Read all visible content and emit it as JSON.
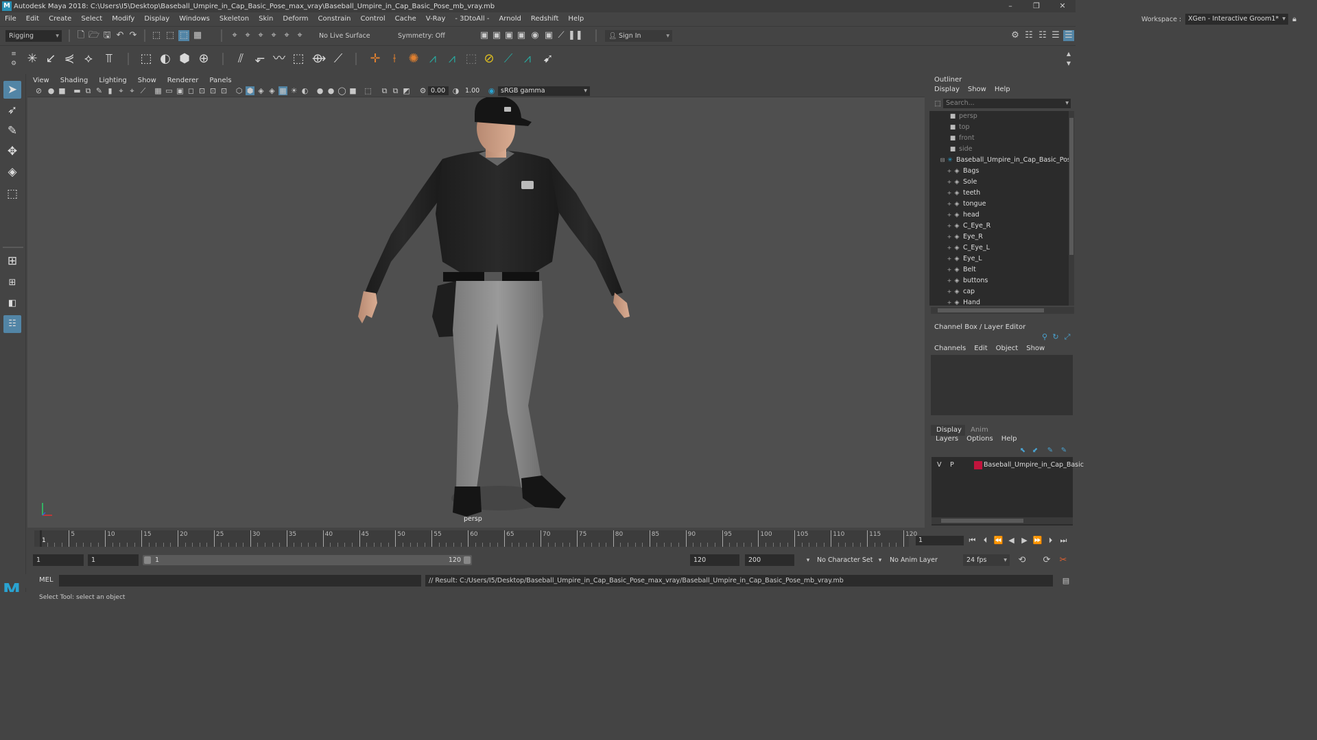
{
  "titlebar": {
    "title": "Autodesk Maya 2018: C:\\Users\\I5\\Desktop\\Baseball_Umpire_in_Cap_Basic_Pose_max_vray\\Baseball_Umpire_in_Cap_Basic_Pose_mb_vray.mb",
    "minimize": "–",
    "restore": "❐",
    "close": "✕"
  },
  "menubar": [
    "File",
    "Edit",
    "Create",
    "Select",
    "Modify",
    "Display",
    "Windows",
    "Skeleton",
    "Skin",
    "Deform",
    "Constrain",
    "Control",
    "Cache",
    "V-Ray",
    "- 3DtoAll -",
    "Arnold",
    "Redshift",
    "Help"
  ],
  "workspace": {
    "label": "Workspace :",
    "value": "XGen - Interactive Groom1*"
  },
  "statusline": {
    "menuset": "Rigging",
    "live_surface": "No Live Surface",
    "symmetry": "Symmetry: Off",
    "sign_in": "Sign In"
  },
  "viewport": {
    "menus": [
      "View",
      "Shading",
      "Lighting",
      "Show",
      "Renderer",
      "Panels"
    ],
    "exposure": "0.00",
    "gamma": "1.00",
    "colorspace": "sRGB gamma",
    "camera": "persp"
  },
  "outliner": {
    "title": "Outliner",
    "menus": [
      "Display",
      "Show",
      "Help"
    ],
    "search_placeholder": "Search...",
    "cameras": [
      "persp",
      "top",
      "front",
      "side"
    ],
    "root": "Baseball_Umpire_in_Cap_Basic_Pose_m",
    "children": [
      "Bags",
      "Sole",
      "teeth",
      "tongue",
      "head",
      "C_Eye_R",
      "Eye_R",
      "C_Eye_L",
      "Eye_L",
      "Belt",
      "buttons",
      "cap",
      "Hand"
    ]
  },
  "channelbox": {
    "title": "Channel Box / Layer Editor",
    "menus": [
      "Channels",
      "Edit",
      "Object",
      "Show"
    ],
    "tabs": [
      "Display",
      "Anim"
    ],
    "layer_menus": [
      "Layers",
      "Options",
      "Help"
    ],
    "layer": {
      "v": "V",
      "p": "P",
      "name": "Baseball_Umpire_in_Cap_Basic",
      "color": "#c0143c"
    }
  },
  "timeline": {
    "ticks": [
      1,
      5,
      10,
      15,
      20,
      25,
      30,
      35,
      40,
      45,
      50,
      55,
      60,
      65,
      70,
      75,
      80,
      85,
      90,
      95,
      100,
      105,
      110,
      115,
      120
    ],
    "current_frame": "1"
  },
  "range": {
    "start": "1",
    "playback_start": "1",
    "slider_start": "1",
    "slider_end": "120",
    "playback_end": "120",
    "end": "200",
    "character_set": "No Character Set",
    "anim_layer": "No Anim Layer",
    "fps": "24 fps"
  },
  "cmdline": {
    "lang": "MEL",
    "result": "// Result: C:/Users/I5/Desktop/Baseball_Umpire_in_Cap_Basic_Pose_max_vray/Baseball_Umpire_in_Cap_Basic_Pose_mb_vray.mb"
  },
  "helpline": {
    "text": "Select Tool: select an object"
  }
}
